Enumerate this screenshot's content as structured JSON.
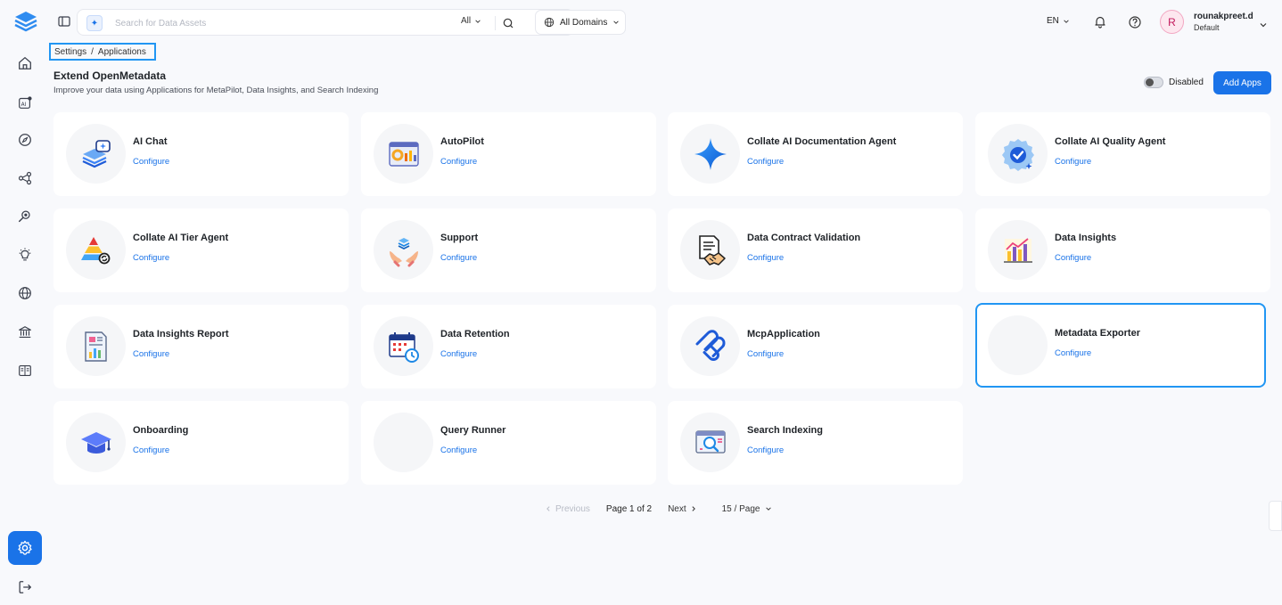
{
  "header": {
    "search": {
      "placeholder": "Search for Data Assets",
      "filter_label": "All"
    },
    "domains_label": "All Domains",
    "language": "EN",
    "user": {
      "initial": "R",
      "name": "rounakpreet.d",
      "role": "Default"
    }
  },
  "breadcrumb": {
    "items": [
      "Settings",
      "Applications"
    ],
    "separator": "/"
  },
  "page": {
    "title": "Extend OpenMetadata",
    "subtitle": "Improve your data using Applications for MetaPilot, Data Insights, and Search Indexing",
    "toggle_label": "Disabled",
    "add_button": "Add Apps"
  },
  "apps": [
    {
      "name": "AI Chat",
      "action": "Configure",
      "icon": "ai-chat-icon"
    },
    {
      "name": "AutoPilot",
      "action": "Configure",
      "icon": "autopilot-icon"
    },
    {
      "name": "Collate AI Documentation Agent",
      "action": "Configure",
      "icon": "sparkle-icon"
    },
    {
      "name": "Collate AI Quality Agent",
      "action": "Configure",
      "icon": "quality-badge-icon"
    },
    {
      "name": "Collate AI Tier Agent",
      "action": "Configure",
      "icon": "tier-pyramid-icon"
    },
    {
      "name": "Support",
      "action": "Configure",
      "icon": "support-hands-icon"
    },
    {
      "name": "Data Contract Validation",
      "action": "Configure",
      "icon": "contract-handshake-icon"
    },
    {
      "name": "Data Insights",
      "action": "Configure",
      "icon": "bar-chart-icon"
    },
    {
      "name": "Data Insights Report",
      "action": "Configure",
      "icon": "report-icon"
    },
    {
      "name": "Data Retention",
      "action": "Configure",
      "icon": "calendar-clock-icon"
    },
    {
      "name": "McpApplication",
      "action": "Configure",
      "icon": "mcp-logo-icon"
    },
    {
      "name": "Metadata Exporter",
      "action": "Configure",
      "icon": "blank-icon"
    },
    {
      "name": "Onboarding",
      "action": "Configure",
      "icon": "graduation-cap-icon"
    },
    {
      "name": "Query Runner",
      "action": "Configure",
      "icon": "blank-icon"
    },
    {
      "name": "Search Indexing",
      "action": "Configure",
      "icon": "search-window-icon"
    }
  ],
  "pagination": {
    "previous": "Previous",
    "page_info": "Page 1 of 2",
    "next": "Next",
    "per_page": "15 / Page"
  },
  "colors": {
    "accent": "#1a73e8",
    "selected_border": "#2196f3",
    "background": "#f8f9fc"
  }
}
